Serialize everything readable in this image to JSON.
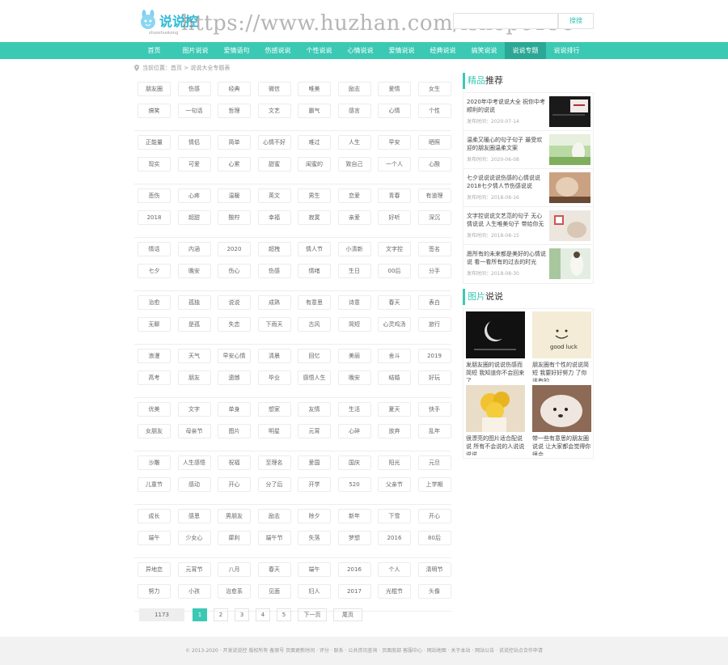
{
  "header": {
    "logo_text": "说说控",
    "logo_sub": "shuoshuokong",
    "watermark": "https://www.huzhan.com/ishop6196",
    "search_placeholder": "",
    "search_button": "搜搜"
  },
  "nav": {
    "items": [
      "首页",
      "图片说说",
      "爱情语句",
      "伤感说说",
      "个性说说",
      "心情说说",
      "爱情说说",
      "经典说说",
      "搞笑说说",
      "说说专题",
      "说说排行"
    ],
    "active_index": 9
  },
  "breadcrumb": "当前位置：首页 > 说说大全专题表",
  "tag_groups": [
    [
      [
        "朋友圈",
        "伤感",
        "经典",
        "微信",
        "唯美",
        "励志",
        "爱情",
        "女生"
      ],
      [
        "搞笑",
        "一句话",
        "哲理",
        "文艺",
        "霸气",
        "感言",
        "心情",
        "个性"
      ]
    ],
    [
      [
        "正能量",
        "情侣",
        "简单",
        "心情不好",
        "难过",
        "人生",
        "早安",
        "晒照"
      ],
      [
        "现实",
        "可爱",
        "心累",
        "甜蜜",
        "闺蜜的",
        "致自己",
        "一个人",
        "心酸"
      ]
    ],
    [
      [
        "悲伤",
        "心疼",
        "温暖",
        "英文",
        "男生",
        "恋爱",
        "青春",
        "有道理"
      ],
      [
        "2018",
        "超甜",
        "酸柠",
        "幸福",
        "寂寞",
        "亲爱",
        "好听",
        "深沉"
      ]
    ],
    [
      [
        "情话",
        "内涵",
        "2020",
        "超拽",
        "情人节",
        "小清新",
        "文字控",
        "签名"
      ],
      [
        "七夕",
        "晚安",
        "伤心",
        "伤感",
        "情绪",
        "生日",
        "00后",
        "分手"
      ]
    ],
    [
      [
        "治愈",
        "孤独",
        "说说",
        "成熟",
        "有意思",
        "诗意",
        "春天",
        "表白"
      ],
      [
        "无聊",
        "是孤",
        "失恋",
        "下雨天",
        "古风",
        "简短",
        "心灵鸡汤",
        "旅行"
      ]
    ],
    [
      [
        "浪漫",
        "天气",
        "早安心情",
        "清晨",
        "回忆",
        "美丽",
        "舍斗",
        "2019"
      ],
      [
        "高考",
        "朋友",
        "遗憾",
        "毕业",
        "感悟人生",
        "晚安",
        "结婚",
        "好玩"
      ]
    ],
    [
      [
        "优美",
        "文字",
        "单身",
        "想家",
        "友情",
        "生活",
        "夏天",
        "快手"
      ],
      [
        "女朋友",
        "母亲节",
        "图片",
        "明星",
        "元宵",
        "心碎",
        "放弃",
        "乱年"
      ]
    ],
    [
      [
        "沙雕",
        "人生感悟",
        "祝福",
        "至理名",
        "爱国",
        "国庆",
        "阳光",
        "元旦"
      ],
      [
        "儿童节",
        "感动",
        "开心",
        "分了后",
        "开学",
        "520",
        "父亲节",
        "上学期"
      ]
    ],
    [
      [
        "成长",
        "感恩",
        "男朋友",
        "励志",
        "除夕",
        "新年",
        "下雪",
        "开心"
      ],
      [
        "端午",
        "少女心",
        "犀利",
        "端午节",
        "失落",
        "梦想",
        "2016",
        "80后"
      ]
    ],
    [
      [
        "异地恋",
        "元宵节",
        "八月",
        "春天",
        "端午",
        "2016",
        "个人",
        "清明节"
      ],
      [
        "努力",
        "小孩",
        "治愈系",
        "见面",
        "妇人",
        "2017",
        "光棍节",
        "头像"
      ]
    ]
  ],
  "pagination": {
    "total": "1173",
    "pages": [
      "1",
      "2",
      "3",
      "4",
      "5"
    ],
    "next": "下一页",
    "last": "尾页"
  },
  "sidebar": {
    "featured_title_accent": "精品",
    "featured_title_rest": "推荐",
    "featured": [
      {
        "text": "2020年中考说说大全 祝你中考顺利的说说",
        "date": "发布时间：2020-07-14"
      },
      {
        "text": "温柔又暖心的句子句子 最受欢迎的朋友圈温柔文案",
        "date": "发布时间：2020-06-08"
      },
      {
        "text": "七夕说说说说伤感的心情说说 2018七夕情人节伤感说说",
        "date": "发布时间：2018-08-16"
      },
      {
        "text": "文字控说说文艺范的句子 无心情说说 人生唯美句子 带给你无尽感悟",
        "date": "发布时间：2018-08-15"
      },
      {
        "text": "愿所有的未来都是美好的心情说说 看一看所有的过去的时光",
        "date": "发布时间：2018-08-30"
      }
    ],
    "pic_title_accent": "图片",
    "pic_title_rest": "说说",
    "pics": [
      {
        "caption": "发朋友圈的说说伤感而简短 我知道你不会回来了"
      },
      {
        "caption": "朋友圈有个性的说说简短 我要好好努力 了你该有的"
      },
      {
        "caption": "很漂亮的图片适合配说说 所有不会说的人说说说说"
      },
      {
        "caption": "带一些有意思的朋友圈说说 让大家都会觉得你很会"
      }
    ]
  },
  "footer": "© 2013-2020 · 开发说说控 版权所有 备案号 页面更新时间 · 评分 · 联系 · 公共资讯查询 · 页面底部      客服中心 · 网站地图 · 关于本站 · 网站公告 · 说说控站点合作申请"
}
